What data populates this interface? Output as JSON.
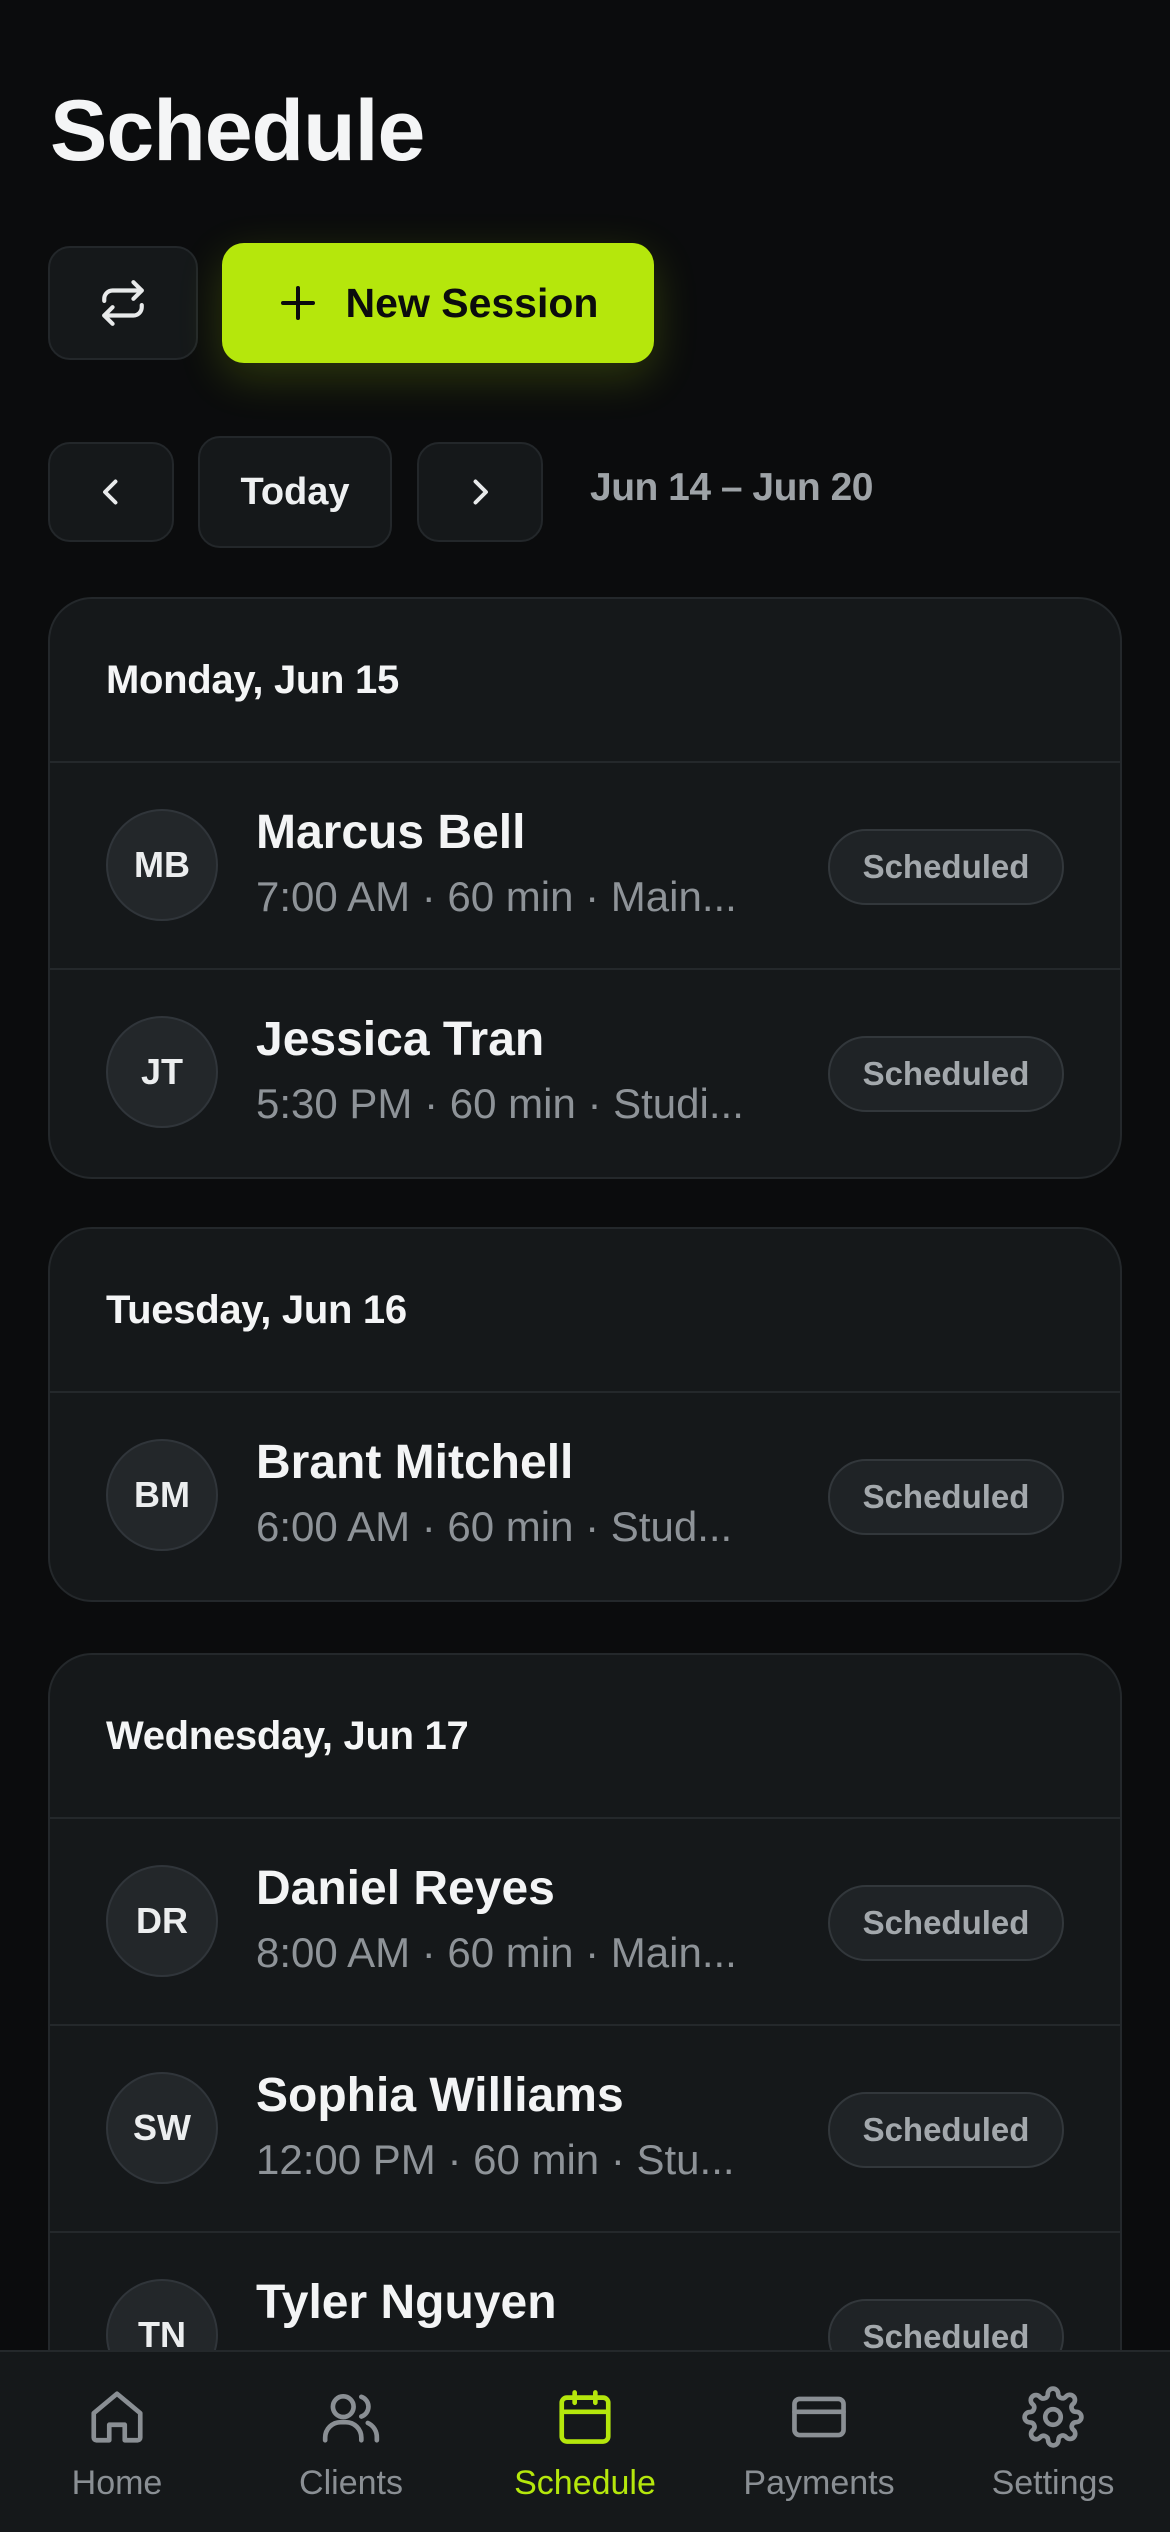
{
  "header": {
    "title": "Schedule"
  },
  "actions": {
    "swap_icon": "swap-arrows-icon",
    "new_session_label": "New Session"
  },
  "date_nav": {
    "today_label": "Today",
    "range": "Jun 14 – Jun 20"
  },
  "days": [
    {
      "label": "Monday, Jun 15",
      "sessions": [
        {
          "initials": "MB",
          "name": "Marcus Bell",
          "meta": "7:00 AM · 60 min · Main...",
          "status": "Scheduled"
        },
        {
          "initials": "JT",
          "name": "Jessica Tran",
          "meta": "5:30 PM · 60 min · Studi...",
          "status": "Scheduled"
        }
      ]
    },
    {
      "label": "Tuesday, Jun 16",
      "sessions": [
        {
          "initials": "BM",
          "name": "Brant Mitchell",
          "meta": "6:00 AM · 60 min · Stud...",
          "status": "Scheduled"
        }
      ]
    },
    {
      "label": "Wednesday, Jun 17",
      "sessions": [
        {
          "initials": "DR",
          "name": "Daniel Reyes",
          "meta": "8:00 AM · 60 min · Main...",
          "status": "Scheduled"
        },
        {
          "initials": "SW",
          "name": "Sophia Williams",
          "meta": "12:00 PM · 60 min · Stu...",
          "status": "Scheduled"
        },
        {
          "initials": "TN",
          "name": "Tyler Nguyen",
          "meta": "",
          "status": "Scheduled"
        }
      ]
    }
  ],
  "tabbar": {
    "items": [
      {
        "label": "Home",
        "icon": "home-icon"
      },
      {
        "label": "Clients",
        "icon": "users-icon"
      },
      {
        "label": "Schedule",
        "icon": "calendar-icon",
        "active": true
      },
      {
        "label": "Payments",
        "icon": "credit-card-icon"
      },
      {
        "label": "Settings",
        "icon": "gear-icon"
      }
    ]
  },
  "colors": {
    "background": "#0b0c0d",
    "card": "#15181a",
    "accent": "#b5e70c",
    "muted": "#8e9398"
  }
}
